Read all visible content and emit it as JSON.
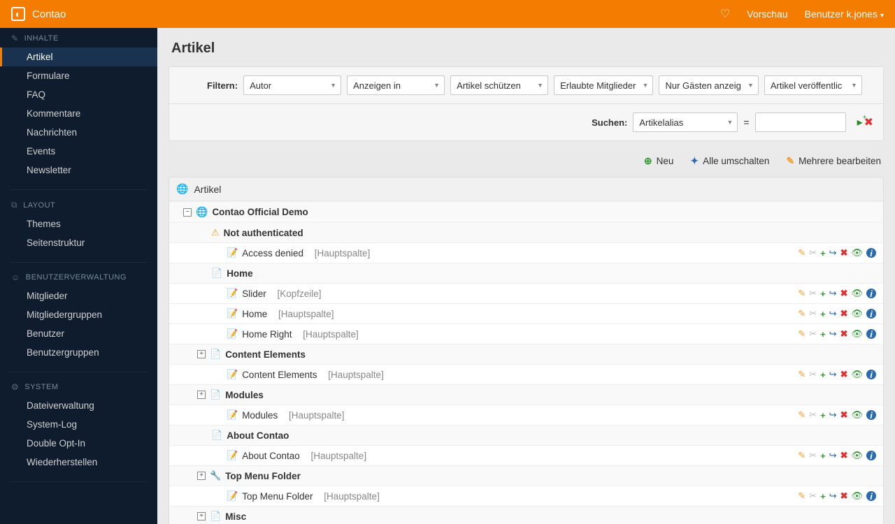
{
  "brand": "Contao",
  "topbar": {
    "preview": "Vorschau",
    "user_label": "Benutzer k.jones"
  },
  "sidebar": {
    "groups": [
      {
        "title": "INHALTE",
        "icon": "✎",
        "items": [
          "Artikel",
          "Formulare",
          "FAQ",
          "Kommentare",
          "Nachrichten",
          "Events",
          "Newsletter"
        ],
        "active": 0
      },
      {
        "title": "LAYOUT",
        "icon": "⧉",
        "items": [
          "Themes",
          "Seitenstruktur"
        ]
      },
      {
        "title": "BENUTZERVERWALTUNG",
        "icon": "☺",
        "items": [
          "Mitglieder",
          "Mitgliedergruppen",
          "Benutzer",
          "Benutzergruppen"
        ]
      },
      {
        "title": "SYSTEM",
        "icon": "⚙",
        "items": [
          "Dateiverwaltung",
          "System-Log",
          "Double Opt-In",
          "Wiederherstellen"
        ]
      }
    ]
  },
  "page_title": "Artikel",
  "filters": {
    "label": "Filtern:",
    "options": [
      "Autor",
      "Anzeigen in",
      "Artikel schützen",
      "Erlaubte Mitglieder",
      "Nur Gästen anzeig",
      "Artikel veröffentlic"
    ]
  },
  "search": {
    "label": "Suchen:",
    "field": "Artikelalias",
    "eq": "="
  },
  "toolbar": {
    "new": "Neu",
    "toggle": "Alle umschalten",
    "multi": "Mehrere bearbeiten"
  },
  "tree": {
    "root": "Artikel",
    "site": "Contao Official Demo",
    "nodes": [
      {
        "type": "page",
        "icon": "warn",
        "label": "Not authenticated",
        "toggle": null,
        "indent": 2
      },
      {
        "type": "article",
        "label": "Access denied",
        "section": "[Hauptspalte]",
        "indent": 3
      },
      {
        "type": "page",
        "icon": "reg",
        "label": "Home",
        "toggle": null,
        "indent": 2
      },
      {
        "type": "article",
        "label": "Slider",
        "section": "[Kopfzeile]",
        "indent": 3
      },
      {
        "type": "article",
        "label": "Home",
        "section": "[Hauptspalte]",
        "indent": 3
      },
      {
        "type": "article",
        "label": "Home Right",
        "section": "[Hauptspalte]",
        "indent": 3
      },
      {
        "type": "page",
        "icon": "reg",
        "label": "Content Elements",
        "toggle": "+",
        "indent": 2
      },
      {
        "type": "article",
        "label": "Content Elements",
        "section": "[Hauptspalte]",
        "indent": 3
      },
      {
        "type": "page",
        "icon": "reg",
        "label": "Modules",
        "toggle": "+",
        "indent": 2
      },
      {
        "type": "article",
        "label": "Modules",
        "section": "[Hauptspalte]",
        "indent": 3
      },
      {
        "type": "page",
        "icon": "reg",
        "label": "About Contao",
        "toggle": null,
        "indent": 2
      },
      {
        "type": "article",
        "label": "About Contao",
        "section": "[Hauptspalte]",
        "indent": 3
      },
      {
        "type": "page",
        "icon": "fold",
        "label": "Top Menu Folder",
        "toggle": "+",
        "indent": 2
      },
      {
        "type": "article",
        "label": "Top Menu Folder",
        "section": "[Hauptspalte]",
        "indent": 3
      },
      {
        "type": "page",
        "icon": "reg",
        "label": "Misc",
        "toggle": "+",
        "indent": 2
      }
    ]
  }
}
